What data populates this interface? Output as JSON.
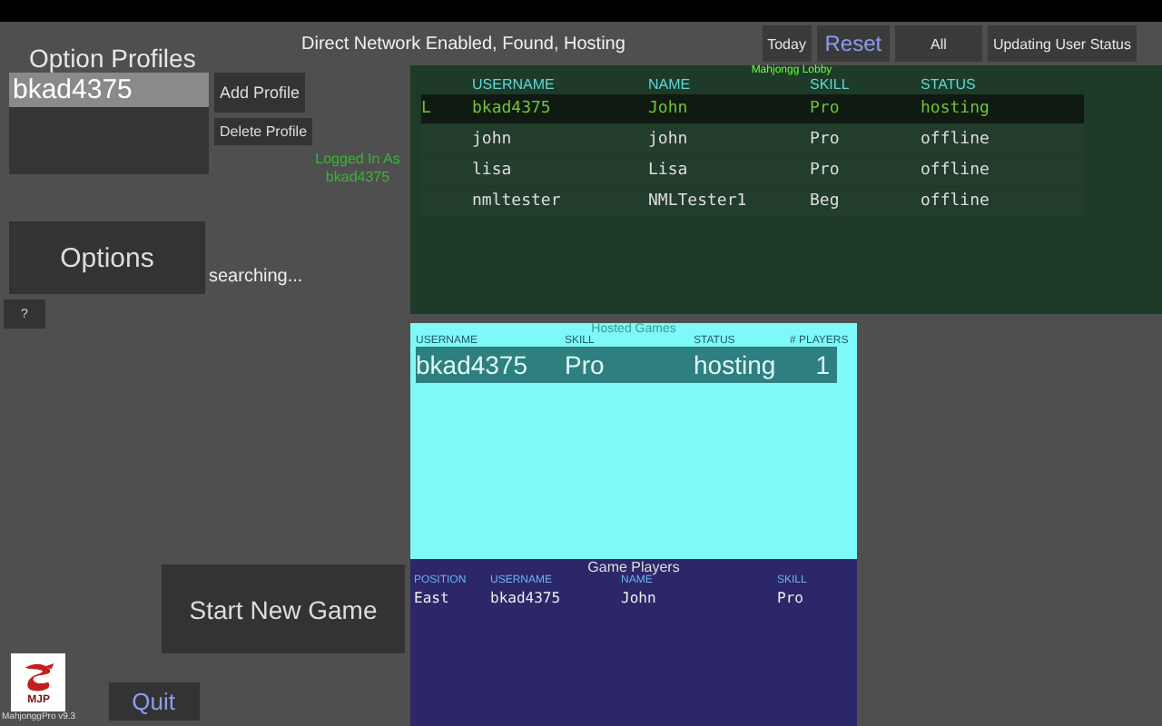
{
  "status_text": "Direct Network Enabled, Found, Hosting",
  "top_buttons": [
    {
      "label": "Today",
      "kind": "plain"
    },
    {
      "label": "Reset",
      "kind": "accent"
    },
    {
      "label": "All",
      "kind": "wide"
    },
    {
      "label": "Updating User Status",
      "kind": "plain"
    }
  ],
  "profiles": {
    "title": "Option Profiles",
    "items": [
      {
        "label": "bkad4375",
        "selected": true
      }
    ],
    "buttons": [
      "Add Profile",
      "Delete Profile"
    ]
  },
  "login_status": "Logged In As bkad4375",
  "options_button": "Options",
  "search_status": "searching...",
  "help_button": "?",
  "start_button": "Start New Game",
  "quit_button": "Quit",
  "logo": {
    "mark": "MJP",
    "caption": "MahjonggPro v9.3"
  },
  "lobby": {
    "title": "Mahjongg Lobby",
    "columns": [
      "USERNAME",
      "NAME",
      "SKILL",
      "STATUS"
    ],
    "rows": [
      {
        "marker": "L",
        "cells": [
          "bkad4375",
          "John",
          "Pro",
          "hosting"
        ],
        "selected": true
      },
      {
        "cells": [
          "john",
          "john",
          "Pro",
          "offline"
        ],
        "selected": false
      },
      {
        "cells": [
          "lisa",
          "Lisa",
          "Pro",
          "offline"
        ],
        "selected": false
      },
      {
        "cells": [
          "nmltester",
          "NMLTester1",
          "Beg",
          "offline"
        ],
        "selected": false
      }
    ]
  },
  "hosted_games": {
    "title": "Hosted Games",
    "columns": [
      "USERNAME",
      "SKILL",
      "STATUS",
      "# PLAYERS"
    ],
    "rows": [
      {
        "cells": [
          "bkad4375",
          "Pro",
          "hosting",
          "1"
        ],
        "selected": true
      }
    ]
  },
  "game_players": {
    "title": "Game Players",
    "columns": [
      "POSITION",
      "USERNAME",
      "NAME",
      "SKILL"
    ],
    "rows": [
      {
        "cells": [
          "East",
          "bkad4375",
          "John",
          "Pro"
        ]
      }
    ]
  }
}
